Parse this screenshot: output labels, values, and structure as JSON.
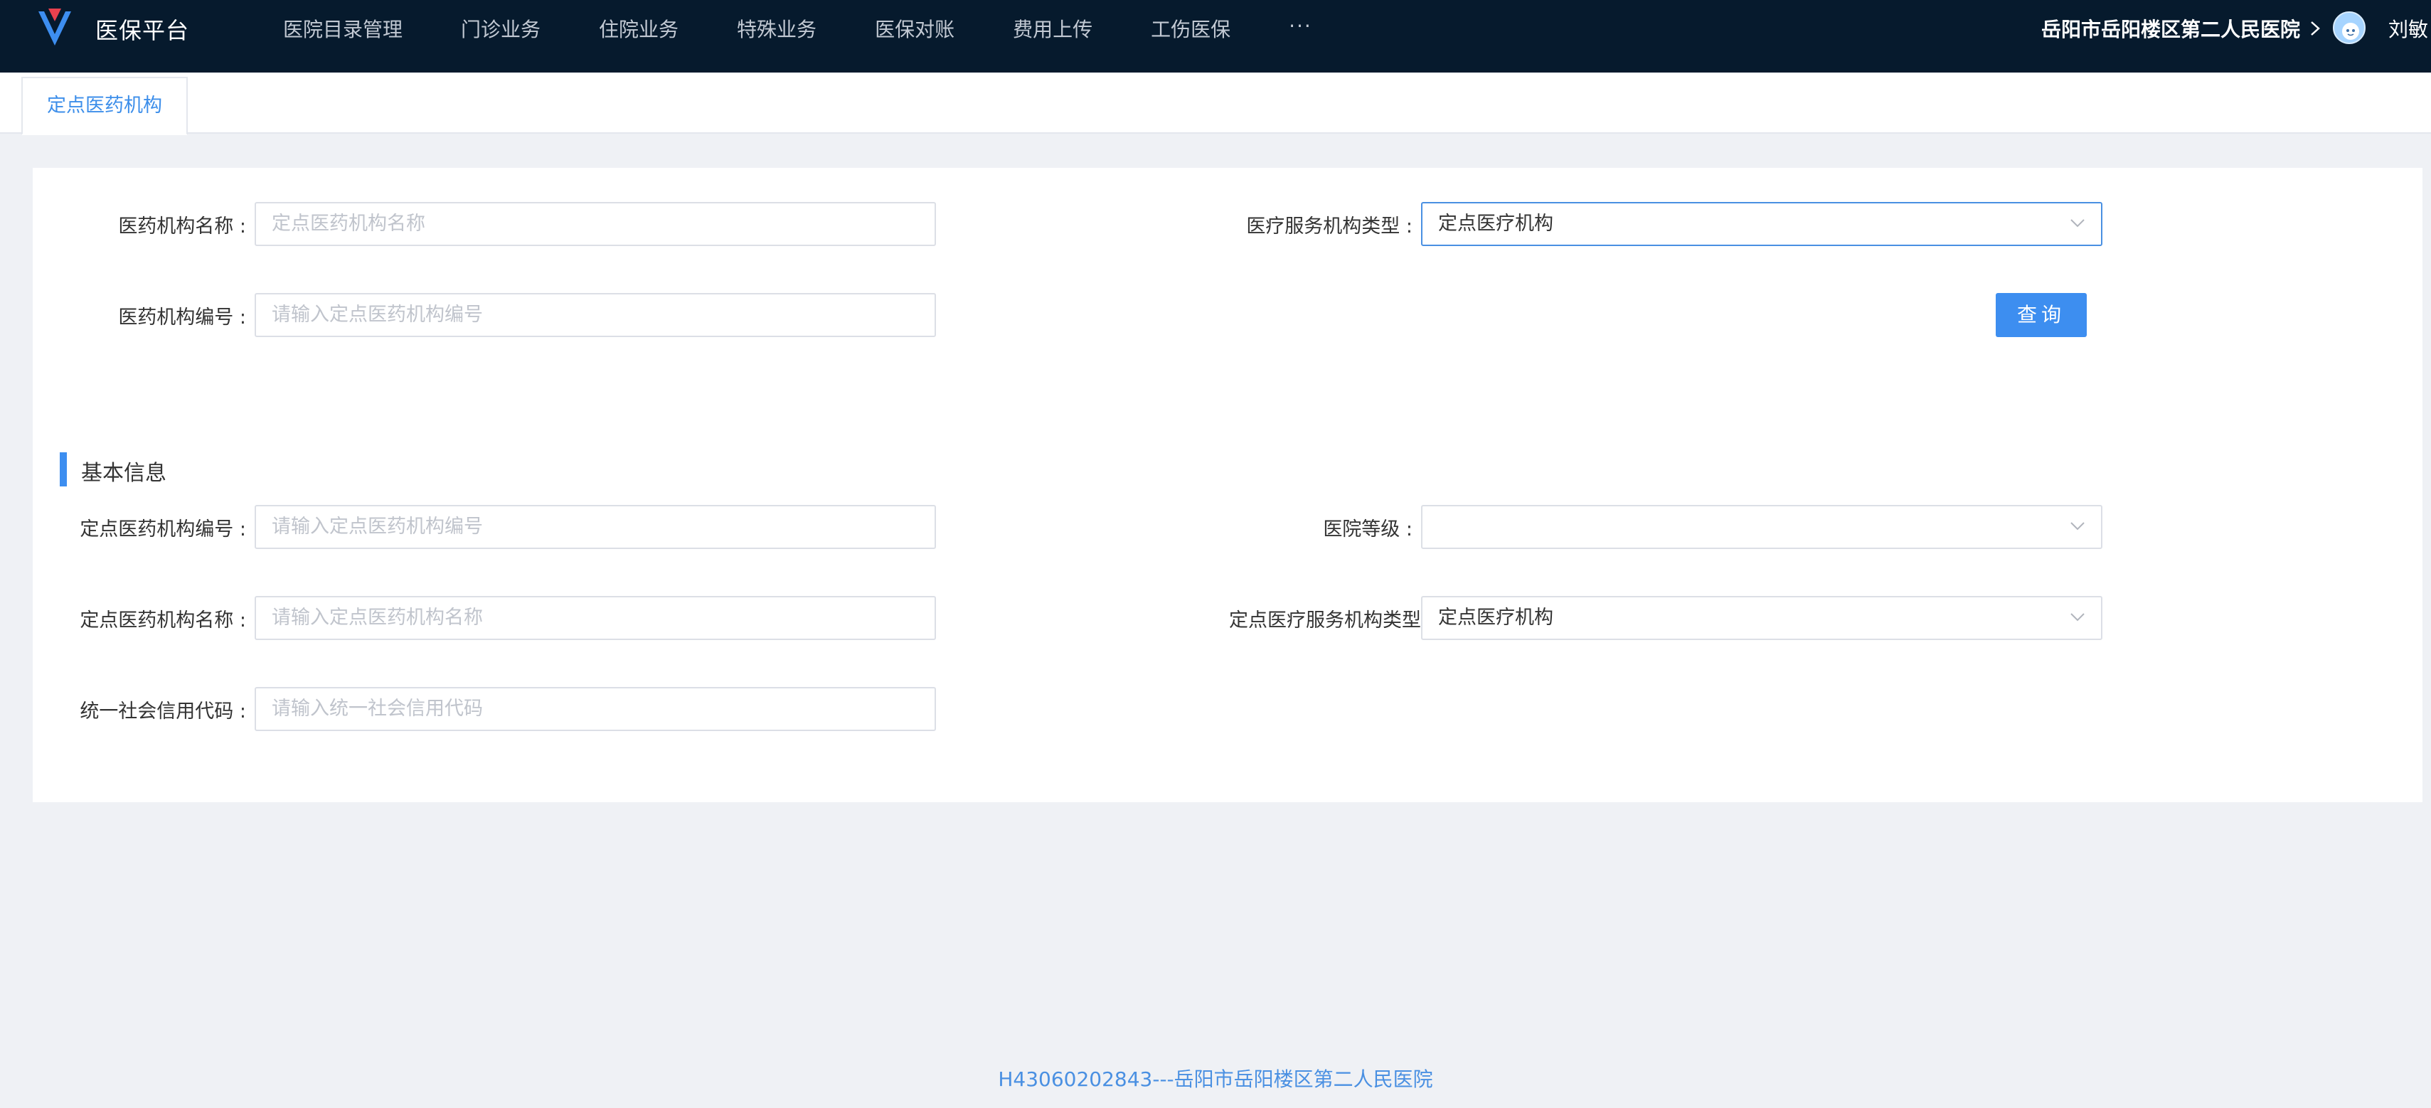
{
  "header": {
    "brand": "医保平台",
    "nav": [
      "医院目录管理",
      "门诊业务",
      "住院业务",
      "特殊业务",
      "医保对账",
      "费用上传",
      "工伤医保"
    ],
    "more": "···",
    "org": "岳阳市岳阳楼区第二人民医院",
    "user": "刘敏"
  },
  "tabs": [
    {
      "label": "定点医药机构"
    }
  ],
  "search": {
    "name_label": "医药机构名称 :",
    "name_placeholder": "定点医药机构名称",
    "type_label": "医疗服务机构类型 :",
    "type_value": "定点医疗机构",
    "code_label": "医药机构编号 :",
    "code_placeholder": "请输入定点医药机构编号",
    "query_button": "查询"
  },
  "basic": {
    "title": "基本信息",
    "code_label": "定点医药机构编号 :",
    "code_placeholder": "请输入定点医药机构编号",
    "level_label": "医院等级 :",
    "level_value": "",
    "name_label": "定点医药机构名称 :",
    "name_placeholder": "请输入定点医药机构名称",
    "service_type_label": "定点医疗服务机构类型",
    "service_type_value": "定点医疗机构",
    "credit_label": "统一社会信用代码 :",
    "credit_placeholder": "请输入统一社会信用代码"
  },
  "footer": "H43060202843---岳阳市岳阳楼区第二人民医院",
  "colors": {
    "header_bg": "#061a2d",
    "accent": "#3d8ef0",
    "page_bg": "#eff1f5"
  }
}
